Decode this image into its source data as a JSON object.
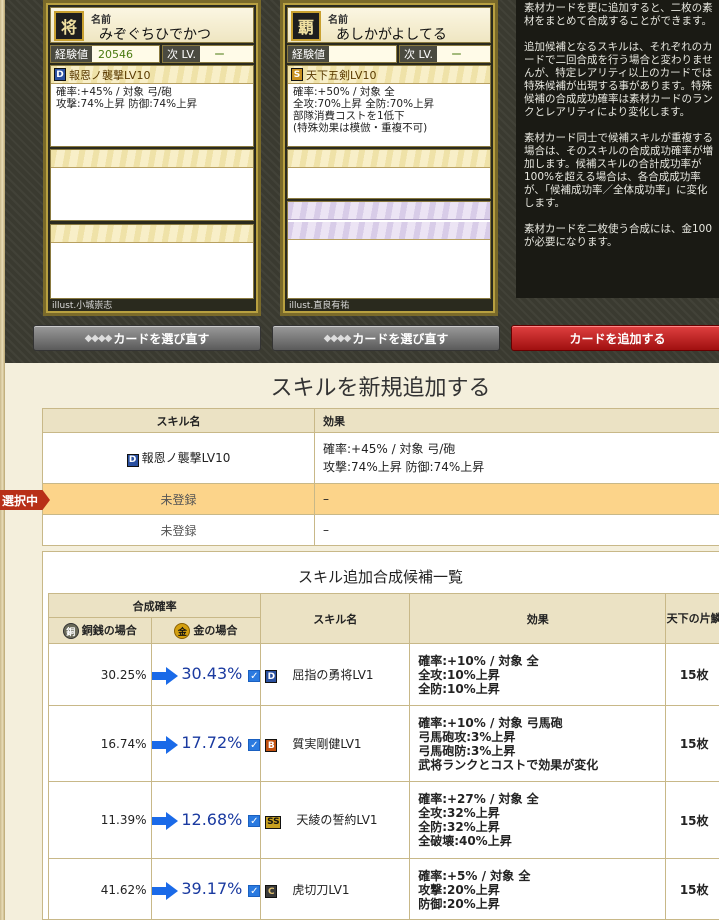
{
  "cards": [
    {
      "emblem": "将",
      "name_label": "名前",
      "name": "みぞぐちひでかつ",
      "exp_label": "経験値",
      "exp_value": "20546",
      "next_label": "次 LV.",
      "next_value": "ー",
      "skill": {
        "grade": "D",
        "title": "報恩ノ襲撃LV10",
        "lines": [
          "確率:+45% / 対象 弓/砲",
          "攻撃:74%上昇 防御:74%上昇"
        ]
      },
      "illust": "illust.小城崇志"
    },
    {
      "emblem": "覇",
      "name_label": "名前",
      "name": "あしかがよしてる",
      "exp_label": "経験値",
      "exp_value": "",
      "next_label": "次 LV.",
      "next_value": "ー",
      "skill": {
        "grade": "S",
        "title": "天下五剣LV10",
        "lines": [
          "確率:+50% / 対象 全",
          "全攻:70%上昇 全防:70%上昇",
          "部隊消費コストを1低下",
          "(特殊効果は模倣・重複不可)"
        ]
      },
      "illust": "illust.直良有祐"
    }
  ],
  "info_text": [
    "素材カードを更に追加すると、二枚の素材をまとめて合成することができます。",
    "追加候補となるスキルは、それぞれのカードで二回合成を行う場合と変わりませんが、特定レアリティ以上のカードでは特殊候補が出現する事があります。特殊候補の合成成功確率は素材カードのランクとレアリティにより変化します。",
    "素材カード同士で候補スキルが重複する場合は、そのスキルの合成成功確率が増加します。候補スキルの合計成功率が100%を超える場合は、各合成成功率が、「候補成功率／全体成功率」に変化します。",
    "素材カードを二枚使う合成には、金100が必要になります。"
  ],
  "buttons": {
    "reselect1": "カードを選び直す",
    "reselect2": "カードを選び直す",
    "add_card": "カードを追加する"
  },
  "section_title": "スキルを新規追加する",
  "skill_table": {
    "headers": {
      "name": "スキル名",
      "effect": "効果"
    },
    "rows": [
      {
        "grade": "D",
        "name": "報恩ノ襲撃LV10",
        "effect": [
          "確率:+45% / 対象 弓/砲",
          "攻撃:74%上昇 防御:74%上昇"
        ]
      },
      {
        "name": "未登録",
        "effect": [
          "–"
        ]
      },
      {
        "name": "未登録",
        "effect": [
          "–"
        ]
      }
    ],
    "selected_tag": "選択中"
  },
  "candidates": {
    "title": "スキル追加合成候補一覧",
    "headers": {
      "rate": "合成確率",
      "copper": "銅銭の場合",
      "gold": "金の場合",
      "name": "スキル名",
      "effect": "効果",
      "count": "天下の片鱗"
    },
    "rows": [
      {
        "copper": "30.25%",
        "gold": "30.43%",
        "grade": "D",
        "name": "屈指の勇将LV1",
        "effect": [
          "確率:+10% / 対象 全",
          "全攻:10%上昇",
          "全防:10%上昇"
        ],
        "count": "15枚"
      },
      {
        "copper": "16.74%",
        "gold": "17.72%",
        "grade": "B",
        "name": "質実剛健LV1",
        "effect": [
          "確率:+10% / 対象 弓馬砲",
          "弓馬砲攻:3%上昇",
          "弓馬砲防:3%上昇",
          "武将ランクとコストで効果が変化"
        ],
        "count": "15枚"
      },
      {
        "copper": "11.39%",
        "gold": "12.68%",
        "grade": "SS",
        "name": "天綾の誓約LV1",
        "effect": [
          "確率:+27% / 対象 全",
          "全攻:32%上昇",
          "全防:32%上昇",
          "全破壊:40%上昇"
        ],
        "count": "15枚"
      },
      {
        "copper": "41.62%",
        "gold": "39.17%",
        "grade": "C",
        "name": "虎切刀LV1",
        "effect": [
          "確率:+5% / 対象 全",
          "攻撃:20%上昇",
          "防御:20%上昇"
        ],
        "count": "15枚"
      }
    ]
  },
  "icons": {
    "arrow": "right-arrow-icon",
    "check": "checkbox-checked-icon",
    "copper_coin": "copper-coin-icon",
    "gold_coin": "gold-coin-icon"
  }
}
